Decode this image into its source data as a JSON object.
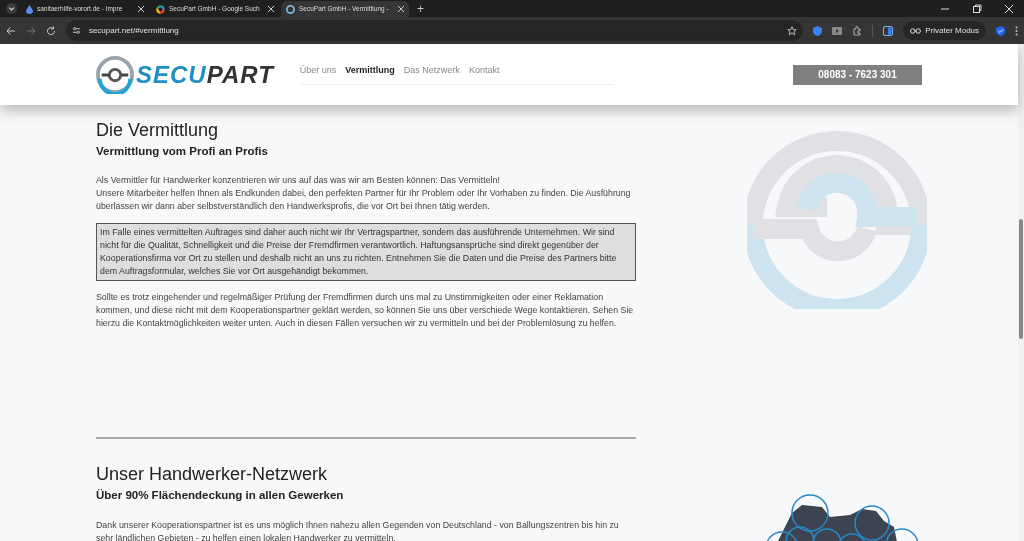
{
  "browser": {
    "tabs": [
      {
        "title": "sanitaerhilfe-vorort.de - Impre",
        "selected": false
      },
      {
        "title": "SecuPart GmbH - Google Such",
        "selected": false
      },
      {
        "title": "SecuPart GmbH - Vermittlung -",
        "selected": true
      }
    ],
    "new_tab": "+",
    "url": "secupart.net/#vermittlung",
    "private_mode": "Privater Modus"
  },
  "header": {
    "logo": {
      "part_1": "SECU",
      "part_2": "PART"
    },
    "nav": [
      {
        "label": "Über uns",
        "selected": false
      },
      {
        "label": "Vermittlung",
        "selected": true
      },
      {
        "label": "Das Netzwerk",
        "selected": false
      },
      {
        "label": "Kontakt",
        "selected": false
      }
    ],
    "phone": "08083 - 7623 301"
  },
  "sections": [
    {
      "title": "Die Vermittlung",
      "subtitle": "Vermittlung vom Profi an Profis",
      "blocks": [
        {
          "kind": "text",
          "text": "Als Vermittler für Handwerker konzentrieren wir uns auf das was wir am Besten können: Das Vermitteln!\nUnsere Mitarbeiter helfen Ihnen als Endkunden dabei, den perfekten Partner für Ihr Problem oder Ihr Vorhaben zu finden. Die Ausführung überlassen wir dann aber selbstverständlich den Handwerksprofis, die vor Ort bei Ihnen tätig werden."
        },
        {
          "kind": "notice",
          "text": "Im Falle eines vermittelten Auftrages sind daher auch nicht wir Ihr Vertragspartner, sondern das ausführende Unternehmen. Wir sind nicht für die Qualität, Schnelligkeit und die Preise der Fremdfirmen verantwortlich. Haftungsansprüche sind direkt gegenüber der Kooperationsfirma vor Ort zu stellen und deshalb nicht an uns zu richten. Entnehmen Sie die Daten und die Preise des Partners bitte dem Auftragsformular, welches Sie vor Ort ausgehändigt bekommen."
        },
        {
          "kind": "text",
          "text": "Sollte es trotz eingehender und regelmäßiger Prüfung der Fremdfirmen durch uns mal zu Unstimmigkeiten oder einer Reklamation kommen, und diese nicht mit dem Kooperationspartner geklärt werden, so können Sie uns über verschiede Wege kontaktieren. Sehen Sie hierzu die Kontaktmöglichkeiten weiter unten. Auch in diesen Fällen versuchen wir zu vermitteln und bei der Problemlösung zu helfen."
        }
      ],
      "art": {
        "kind": "logo"
      }
    },
    {
      "title": "Unser Handwerker-Netzwerk",
      "subtitle": "Über 90% Flächendeckung in allen Gewerken",
      "blocks": [
        {
          "kind": "text",
          "text": "Dank unserer Kooperationspartner ist es uns möglich Ihnen nahezu allen Gegenden von Deutschland - von Ballungszentren bis hin zu sehr ländlichen Gebieten - zu helfen einen lokalen Handwerker zu vermitteln."
        }
      ],
      "art": {
        "kind": "map"
      }
    }
  ]
}
